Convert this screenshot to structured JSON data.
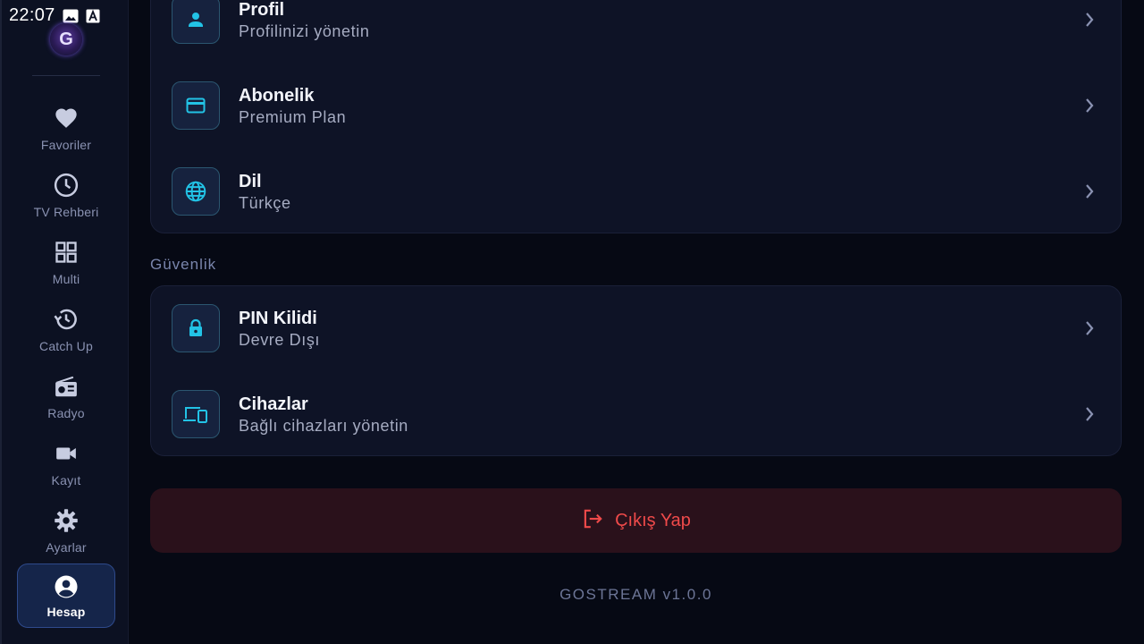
{
  "status_bar": {
    "time": "22:07"
  },
  "sidebar": {
    "items": [
      {
        "label": "Favoriler",
        "icon": "heart-icon"
      },
      {
        "label": "TV Rehberi",
        "icon": "clock-icon"
      },
      {
        "label": "Multi",
        "icon": "grid-icon"
      },
      {
        "label": "Catch Up",
        "icon": "history-icon"
      },
      {
        "label": "Radyo",
        "icon": "radio-icon"
      },
      {
        "label": "Kayıt",
        "icon": "video-camera-icon"
      },
      {
        "label": "Ayarlar",
        "icon": "gear-icon"
      },
      {
        "label": "Hesap",
        "icon": "account-icon",
        "active": true
      }
    ]
  },
  "account_section": {
    "rows": [
      {
        "title": "Profil",
        "subtitle": "Profilinizi yönetin",
        "icon": "person-icon"
      },
      {
        "title": "Abonelik",
        "subtitle": "Premium Plan",
        "icon": "credit-card-icon"
      },
      {
        "title": "Dil",
        "subtitle": "Türkçe",
        "icon": "globe-icon"
      }
    ]
  },
  "security_section": {
    "title": "Güvenlik",
    "rows": [
      {
        "title": "PIN Kilidi",
        "subtitle": "Devre Dışı",
        "icon": "lock-icon"
      },
      {
        "title": "Cihazlar",
        "subtitle": "Bağlı cihazları yönetin",
        "icon": "devices-icon"
      }
    ]
  },
  "logout": {
    "label": "Çıkış Yap",
    "icon": "logout-icon"
  },
  "footer": {
    "version": "GOSTREAM v1.0.0"
  },
  "colors": {
    "accent": "#22c3e6",
    "danger": "#ef4a4a",
    "background": "#060914",
    "card": "#0e1326"
  }
}
